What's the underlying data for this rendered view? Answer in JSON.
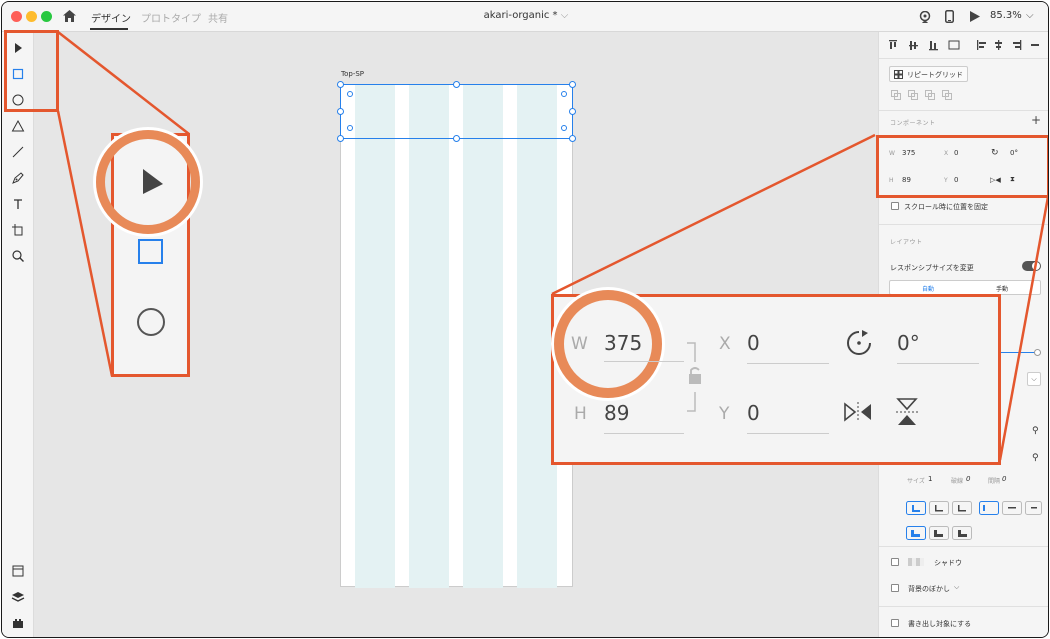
{
  "titlebar": {
    "tabs": [
      "デザイン",
      "プロトタイプ",
      "共有"
    ],
    "doc_title": "akari-organic *",
    "zoom": "85.3%"
  },
  "artboard": {
    "name": "Top-SP"
  },
  "right_panel": {
    "repeat_grid_label": "リピートグリッド",
    "component_header": "コンポーネント",
    "w_label": "W",
    "w_value": "375",
    "h_label": "H",
    "h_value": "89",
    "x_label": "X",
    "x_value": "0",
    "y_label": "Y",
    "y_value": "0",
    "rotation_value": "0°",
    "fix_on_scroll": "スクロール時に位置を固定",
    "layout_header": "レイアウト",
    "responsive_resize": "レスポンシブサイズを変更",
    "auto_label": "自動",
    "manual_label": "手動",
    "size_label": "サイズ",
    "size_value": "1",
    "dash_label": "破線",
    "dash_value": "0",
    "gap_label": "間隔",
    "gap_value": "0",
    "shadow_label": "シャドウ",
    "bg_blur_label": "背景のぼかし",
    "export_label": "書き出し対象にする"
  },
  "colors": {
    "accent": "#2680eb",
    "callout": "#e4572e",
    "grid_column": "#e4f2f3"
  }
}
